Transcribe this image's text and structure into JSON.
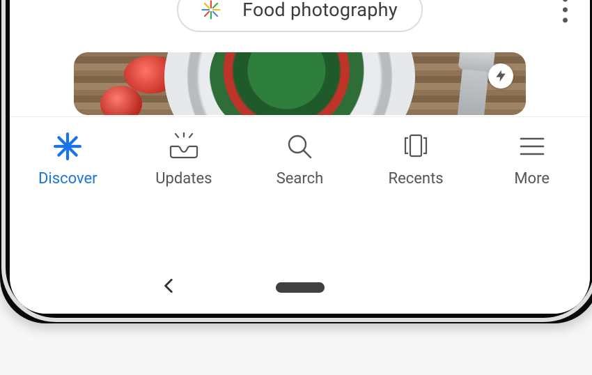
{
  "topbar": {
    "query_label": "Food photography"
  },
  "card": {
    "amp": true
  },
  "nav": {
    "items": [
      {
        "label": "Discover",
        "active": true
      },
      {
        "label": "Updates"
      },
      {
        "label": "Search"
      },
      {
        "label": "Recents"
      },
      {
        "label": "More"
      }
    ]
  }
}
